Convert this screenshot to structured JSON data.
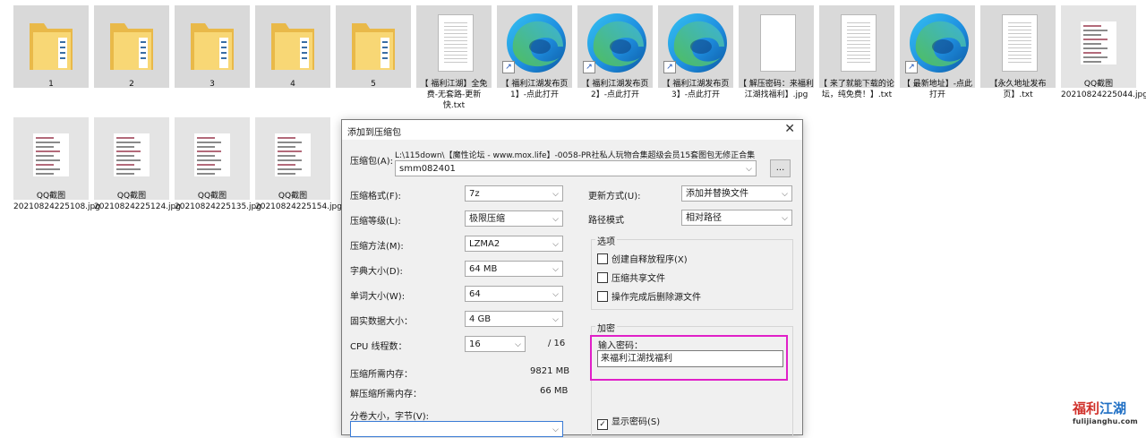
{
  "desktop": {
    "files_row1": [
      {
        "label": "1",
        "type": "folder"
      },
      {
        "label": "2",
        "type": "folder"
      },
      {
        "label": "3",
        "type": "folder"
      },
      {
        "label": "4",
        "type": "folder"
      },
      {
        "label": "5",
        "type": "folder"
      },
      {
        "label": "【 福利江湖】全免费-无套路-更新快.txt",
        "type": "text"
      },
      {
        "label": "【 福利江湖发布页1】-点此打开",
        "type": "edge-shortcut"
      },
      {
        "label": "【 福利江湖发布页2】-点此打开",
        "type": "edge-shortcut"
      },
      {
        "label": "【 福利江湖发布页3】-点此打开",
        "type": "edge-shortcut"
      },
      {
        "label": "【 解压密码：来福利江湖找福利】.jpg",
        "type": "blank"
      },
      {
        "label": "【 来了就能下载的论坛，纯免费！】.txt",
        "type": "text"
      },
      {
        "label": "【 最新地址】-点此打开",
        "type": "edge-shortcut"
      },
      {
        "label": "【永久地址发布页】.txt",
        "type": "text"
      },
      {
        "label": "QQ截图20210824225044.jpg",
        "type": "image"
      }
    ],
    "files_row2": [
      {
        "label": "QQ截图20210824225108.jpg",
        "type": "image"
      },
      {
        "label": "QQ截图20210824225124.jpg",
        "type": "image"
      },
      {
        "label": "QQ截图20210824225135.jpg",
        "type": "image"
      },
      {
        "label": "QQ截图20210824225154.jpg",
        "type": "image"
      }
    ]
  },
  "dialog": {
    "title": "添加到压缩包",
    "archive_label": "压缩包(A):",
    "archive_path": "L:\\115down\\【魔性论坛 - www.mox.life】-0058-PR社私人玩物合集超级会员15套图包无修正合集",
    "archive_name": "smm082401",
    "browse_label": "...",
    "left": [
      {
        "label": "压缩格式(F):",
        "value": "7z"
      },
      {
        "label": "压缩等级(L):",
        "value": "极限压缩"
      },
      {
        "label": "压缩方法(M):",
        "value": "LZMA2"
      },
      {
        "label": "字典大小(D):",
        "value": "64 MB"
      },
      {
        "label": "单词大小(W):",
        "value": "64"
      },
      {
        "label": "固实数据大小：",
        "value": "4 GB"
      }
    ],
    "cpu_label": "CPU 线程数：",
    "cpu_value": "16",
    "cpu_total": "/ 16",
    "mem_compress_label": "压缩所需内存：",
    "mem_compress_value": "9821 MB",
    "mem_decompress_label": "解压缩所需内存：",
    "mem_decompress_value": "66 MB",
    "split_label": "分卷大小，字节(V):",
    "split_value": "",
    "update_label": "更新方式(U):",
    "update_value": "添加并替换文件",
    "path_label": "路径模式",
    "path_value": "相对路径",
    "options_title": "选项",
    "options": [
      {
        "label": "创建自释放程序(X)",
        "checked": false
      },
      {
        "label": "压缩共享文件",
        "checked": false
      },
      {
        "label": "操作完成后删除源文件",
        "checked": false
      }
    ],
    "encrypt_title": "加密",
    "password_label": "输入密码：",
    "password_value": "来福利江湖找福利",
    "show_password_label": "显示密码(S)",
    "show_password_checked": true
  },
  "watermark": {
    "line1_a": "福利",
    "line1_b": "江湖",
    "line2": "fulijianghu.com"
  },
  "colors": {
    "highlight": "#e020c8",
    "tile_bg": "#d9d9d9",
    "folder": "#f5c85a"
  }
}
